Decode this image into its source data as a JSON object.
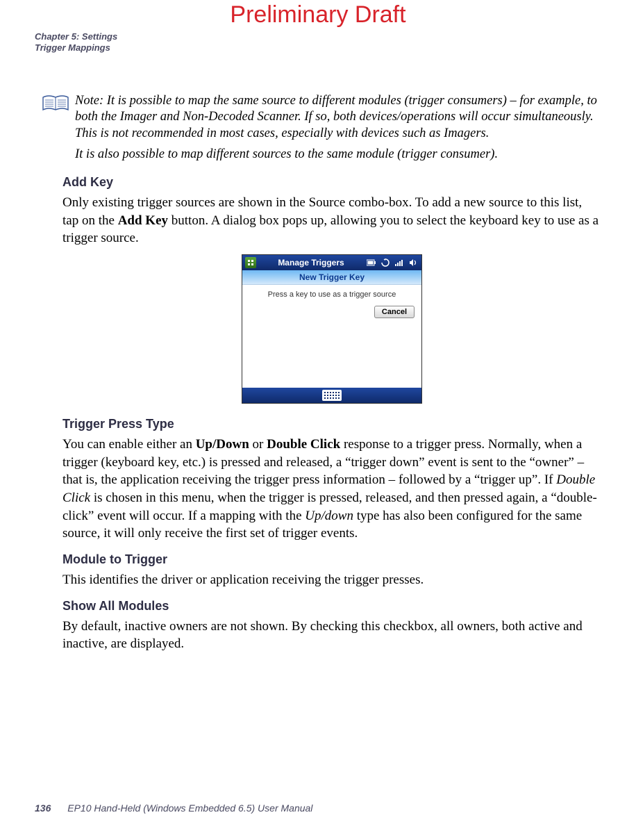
{
  "watermark": "Preliminary Draft",
  "header": {
    "chapter": "Chapter 5: Settings",
    "section": "Trigger Mappings"
  },
  "note": {
    "lead": "Note:",
    "para1": "It is possible to map the same source to different modules (trigger consumers) – for example, to both the Imager and Non-Decoded Scanner. If so, both devices/operations will occur simultaneously. This is not recommended in most cases, especially with devices such as Imagers.",
    "para2": "It is also possible to map different sources to the same module (trigger consumer)."
  },
  "addKey": {
    "heading": "Add Key",
    "body_pre": "Only existing trigger sources are shown in the Source combo-box. To add a new source to this list, tap on the ",
    "body_bold": "Add Key",
    "body_post": " button. A dialog box pops up, allowing you to select the keyboard key to use as a trigger source."
  },
  "screenshot": {
    "titlebar": "Manage Triggers",
    "dialogTitle": "New Trigger Key",
    "prompt": "Press a key to use as a trigger source",
    "cancel": "Cancel"
  },
  "triggerPress": {
    "heading": "Trigger Press Type",
    "t1": "You can enable either an ",
    "b1": "Up/Down",
    "t2": " or ",
    "b2": "Double Click",
    "t3": " response to a trigger press. Normally, when a trigger (keyboard key, etc.) is pressed and released, a “trigger down” event is sent to the “owner” – that is, the application receiving the trigger press information – followed by a “trigger up”. If ",
    "i1": "Double Click",
    "t4": " is chosen in this menu, when the trigger is pressed, released, and then pressed again, a “double-click” event will occur. If a mapping with the ",
    "i2": "Up/down",
    "t5": " type has also been configured for the same source, it will only receive the first set of trigger events."
  },
  "moduleToTrigger": {
    "heading": "Module to Trigger",
    "body": "This identifies the driver or application receiving the trigger presses."
  },
  "showAll": {
    "heading": "Show All Modules",
    "body": "By default, inactive owners are not shown. By checking this checkbox, all owners, both active and inactive, are displayed."
  },
  "footer": {
    "page": "136",
    "title": "EP10 Hand-Held (Windows Embedded 6.5) User Manual"
  }
}
